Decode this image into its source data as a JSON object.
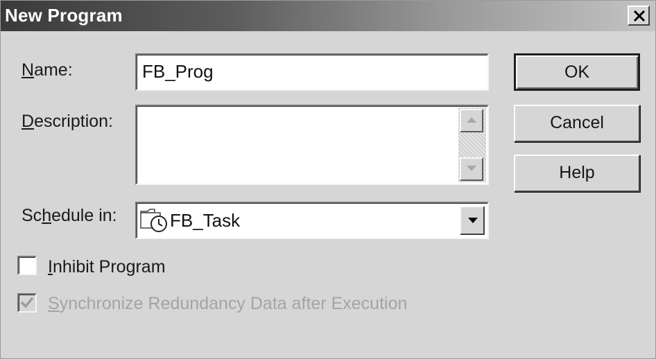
{
  "dialog": {
    "title": "New Program"
  },
  "fields": {
    "name_label_first": "N",
    "name_label_rest": "ame:",
    "name_value": "FB_Prog",
    "description_label_first": "D",
    "description_label_rest": "escription:",
    "description_value": "",
    "schedule_label_before": "Sc",
    "schedule_label_key": "h",
    "schedule_label_after": "edule in:",
    "schedule_value": "FB_Task"
  },
  "buttons": {
    "ok_label": "OK",
    "cancel_label": "Cancel",
    "help_label": "Help"
  },
  "checkboxes": {
    "inhibit_first": "I",
    "inhibit_rest": "nhibit Program",
    "inhibit_checked": false,
    "sync_first": "S",
    "sync_rest": "ynchronize Redundancy Data after Execution",
    "sync_checked": true,
    "sync_enabled": false
  },
  "icons": {
    "close": "close-icon",
    "scroll_up": "arrow-up-icon",
    "scroll_down": "arrow-down-icon",
    "dropdown": "chevron-down-icon",
    "task": "task-folder-clock-icon",
    "checkmark": "checkmark-icon"
  },
  "colors": {
    "window_bg": "#d6d6d6",
    "title_start": "#3a3a3a",
    "title_end": "#c4c4c4",
    "disabled_text": "#a4a4a4"
  }
}
